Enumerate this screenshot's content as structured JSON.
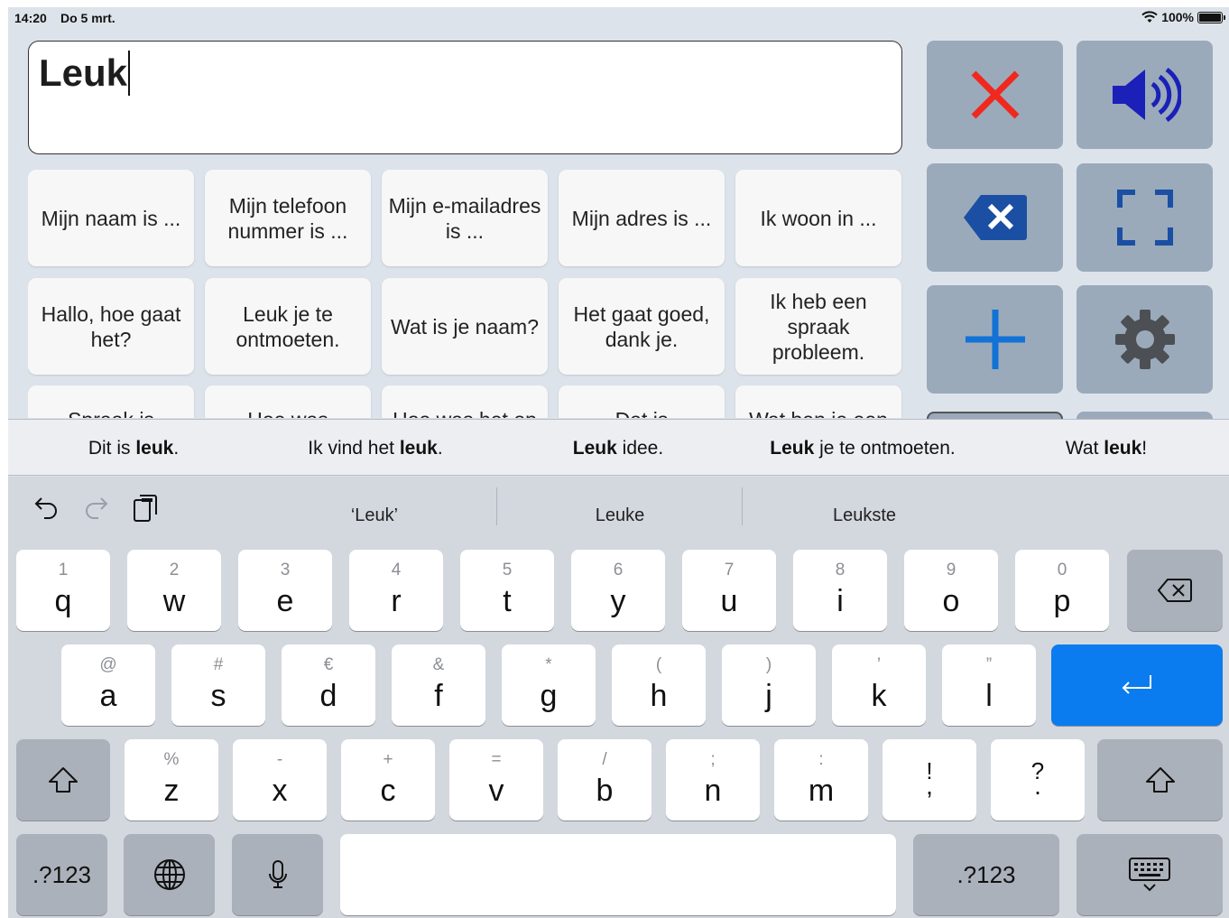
{
  "status": {
    "time": "14:20",
    "date": "Do 5 mrt.",
    "battery": "100%"
  },
  "textbox": {
    "value": "Leuk"
  },
  "phrases": [
    "Mijn naam is ...",
    "Mijn telefoon nummer is ...",
    "Mijn e-mailadres is ...",
    "Mijn adres is ...",
    "Ik woon in ...",
    "Hallo, hoe gaat het?",
    "Leuk je te ontmoeten.",
    "Wat is je naam?",
    "Het gaat goed, dank je.",
    "Ik heb een spraak probleem.",
    "Spraak is",
    "Hoe was",
    "Hoe was het op",
    "Dat is",
    "Wat ben je een"
  ],
  "actions": {
    "clear_icon": "close-x-icon",
    "speak_icon": "speaker-icon",
    "delete_icon": "backspace-icon",
    "fullscreen_icon": "fullscreen-icon",
    "add_icon": "plus-icon",
    "settings_icon": "gear-icon"
  },
  "predictions": [
    {
      "pre": "Dit is ",
      "bold": "leuk",
      "post": "."
    },
    {
      "pre": "Ik vind het ",
      "bold": "leuk",
      "post": "."
    },
    {
      "pre": "",
      "bold": "Leuk",
      "post": " idee."
    },
    {
      "pre": "",
      "bold": "Leuk",
      "post": " je te ontmoeten."
    },
    {
      "pre": "Wat ",
      "bold": "leuk",
      "post": "!"
    }
  ],
  "keyboard": {
    "suggestions": [
      "‘Leuk’",
      "Leuke",
      "Leukste"
    ],
    "row1": [
      [
        "1",
        "q"
      ],
      [
        "2",
        "w"
      ],
      [
        "3",
        "e"
      ],
      [
        "4",
        "r"
      ],
      [
        "5",
        "t"
      ],
      [
        "6",
        "y"
      ],
      [
        "7",
        "u"
      ],
      [
        "8",
        "i"
      ],
      [
        "9",
        "o"
      ],
      [
        "0",
        "p"
      ]
    ],
    "row2": [
      [
        "@",
        "a"
      ],
      [
        "#",
        "s"
      ],
      [
        "€",
        "d"
      ],
      [
        "&",
        "f"
      ],
      [
        "*",
        "g"
      ],
      [
        "(",
        "h"
      ],
      [
        ")",
        "j"
      ],
      [
        "’",
        "k"
      ],
      [
        "”",
        "l"
      ]
    ],
    "row3": [
      [
        "%",
        "z"
      ],
      [
        "-",
        "x"
      ],
      [
        "+",
        "c"
      ],
      [
        "=",
        "v"
      ],
      [
        "/",
        "b"
      ],
      [
        ";",
        "n"
      ],
      [
        ":",
        "m"
      ],
      [
        "!",
        ","
      ],
      [
        "?",
        "."
      ]
    ],
    "numbers_label": ".?123",
    "accent": "#0a7cf0"
  }
}
